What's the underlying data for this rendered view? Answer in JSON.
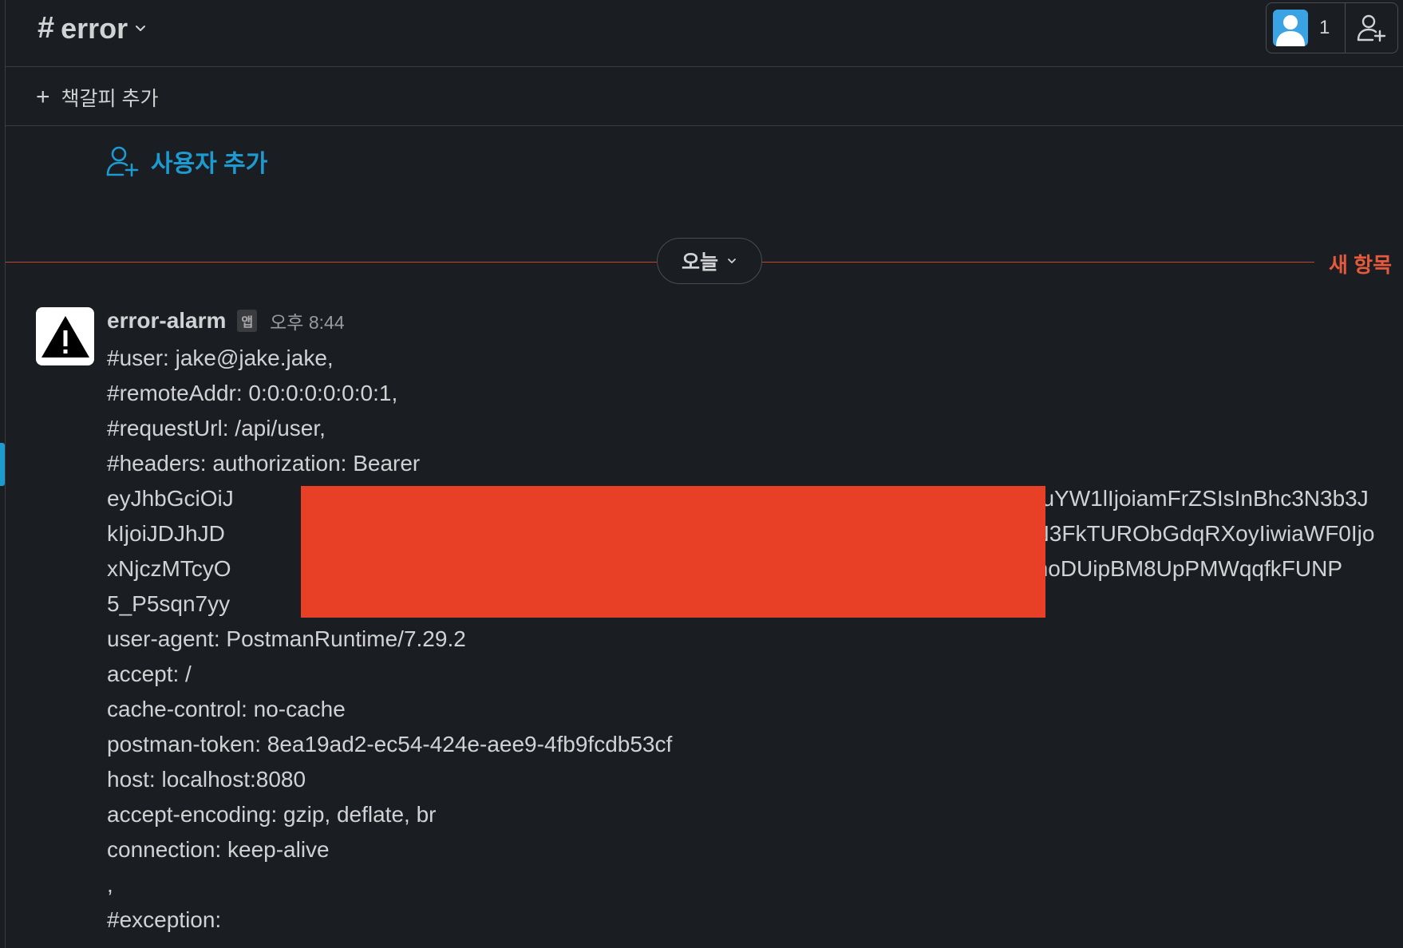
{
  "header": {
    "channel_hash": "#",
    "channel_name": "error",
    "member_count": "1"
  },
  "bookmark": {
    "plus": "+",
    "label": "책갈피 추가"
  },
  "add_user": {
    "label": "사용자 추가"
  },
  "divider": {
    "date_label": "오늘",
    "new_label": "새 항목"
  },
  "message": {
    "sender": "error-alarm",
    "app_badge": "앱",
    "timestamp": "오후 8:44",
    "lines": [
      "#user: jake@jake.jake,",
      "#remoteAddr: 0:0:0:0:0:0:0:1,",
      "#requestUrl: /api/user,",
      "#headers: authorization: Bearer"
    ],
    "token_lines": [
      {
        "left": "eyJhbGciOiJ",
        "right": "VzZXJuYW1lIjoiamFrZSIsInBhc3N3b3J"
      },
      {
        "left": "kIjoiJDJhJD",
        "right": "YHFuN3FkTURObGdqRXoyIiwiaWF0Ijo"
      },
      {
        "left": "xNjczMTcyO",
        "right": "kEUQhoDUipBM8UpPMWqqfkFUNP"
      },
      {
        "left": "5_P5sqn7yy",
        "right": ""
      }
    ],
    "after_lines": [
      "user-agent: PostmanRuntime/7.29.2",
      "accept: /",
      "cache-control: no-cache",
      "postman-token: 8ea19ad2-ec54-424e-aee9-4fb9fcdb53cf",
      "host: localhost:8080",
      "accept-encoding: gzip, deflate, br",
      "connection: keep-alive",
      ",",
      "#exception:"
    ]
  },
  "colors": {
    "background": "#1a1d21",
    "link": "#1d9bd1",
    "new_divider": "#e55a3c",
    "redaction": "#e84026"
  }
}
